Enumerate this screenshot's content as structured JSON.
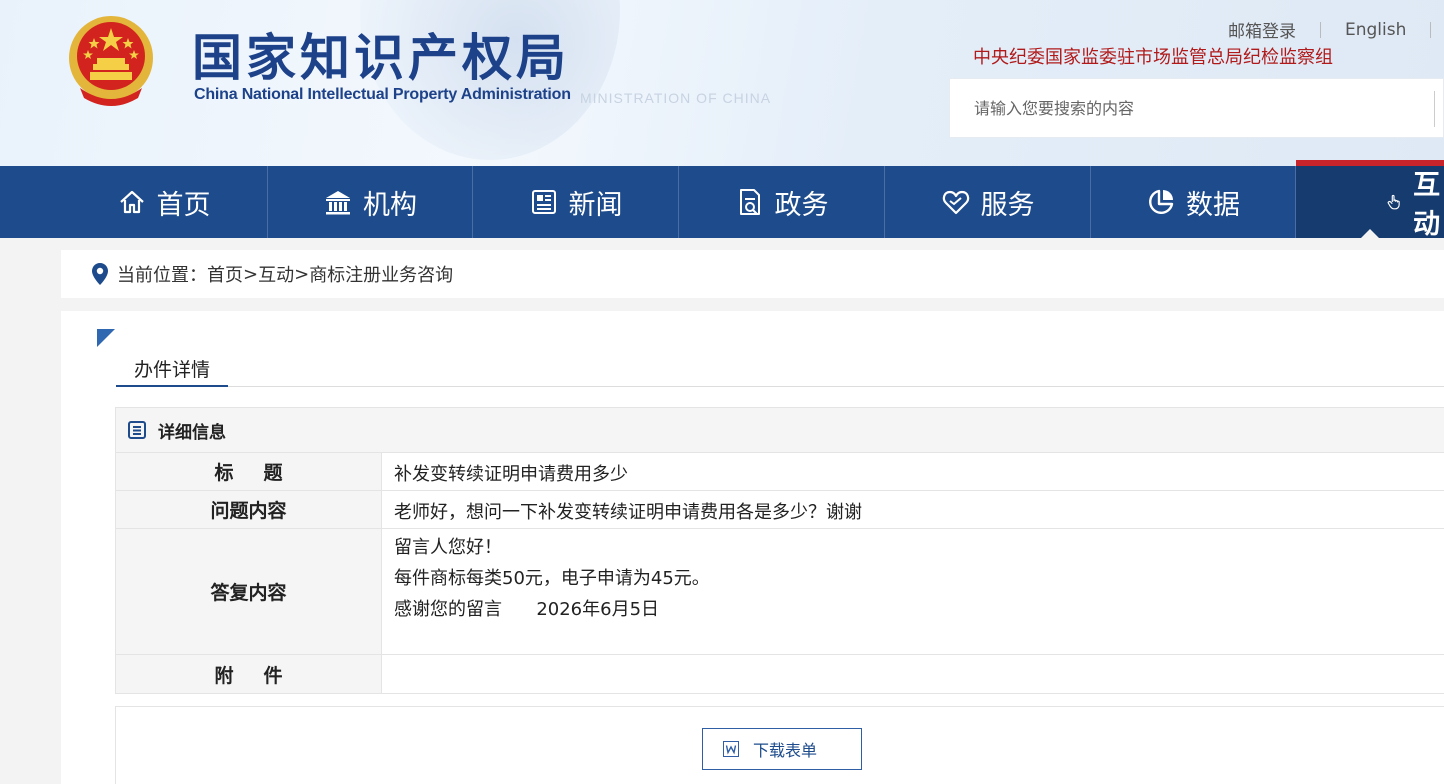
{
  "header": {
    "logo_cn": "国家知识产权局",
    "logo_en": "China National Intellectual Property Administration",
    "ghost_text": "MINISTRATION OF CHINA",
    "top_links": {
      "mail_login": "邮箱登录",
      "english": "English"
    },
    "supervision_link": "中央纪委国家监委驻市场监管总局纪检监察组",
    "search": {
      "placeholder": "请输入您要搜索的内容",
      "value": ""
    }
  },
  "nav": {
    "items": [
      {
        "label": "首页",
        "icon": "home-icon"
      },
      {
        "label": "机构",
        "icon": "institution-icon"
      },
      {
        "label": "新闻",
        "icon": "news-icon"
      },
      {
        "label": "政务",
        "icon": "government-affairs-icon"
      },
      {
        "label": "服务",
        "icon": "service-heart-icon"
      },
      {
        "label": "数据",
        "icon": "pie-chart-icon"
      },
      {
        "label": "互动",
        "icon": "hand-pointer-icon",
        "active": true
      }
    ]
  },
  "breadcrumb": {
    "prefix": "当前位置：",
    "items": [
      "首页",
      "互动",
      "商标注册业务咨询"
    ],
    "separator": ">"
  },
  "tab": {
    "label": "办件详情"
  },
  "detail": {
    "heading": "详细信息",
    "rows": {
      "title_label": "标题",
      "title_value": "补发变转续证明申请费用多少",
      "question_label": "问题内容",
      "question_value": "老师好，想问一下补发变转续证明申请费用各是多少？谢谢",
      "answer_label": "答复内容",
      "answer_lines": [
        "留言人您好！",
        "每件商标每类50元，电子申请为45元。",
        "感谢您的留言      2026年6月5日"
      ],
      "attachment_label": "附件",
      "attachment_value": ""
    }
  },
  "download": {
    "label": "下载表单"
  },
  "colors": {
    "nav_bg": "#1d4b8b",
    "nav_active_bg": "#163b6f",
    "active_accent": "#c7252b",
    "brand_blue": "#1d428a",
    "supervision_red": "#b01a1a"
  }
}
